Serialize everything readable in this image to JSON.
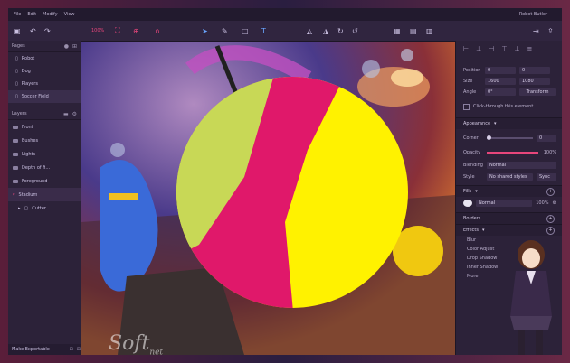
{
  "menu": {
    "items": [
      "File",
      "Edit",
      "Modify",
      "View"
    ],
    "window_title": "Robot Butler"
  },
  "toolbar": {
    "zoom": "100%"
  },
  "pages": {
    "header": "Pages",
    "items": [
      "Robot",
      "Dog",
      "Players",
      "Soccer Field"
    ]
  },
  "layers": {
    "header": "Layers",
    "items": [
      "Front",
      "Bushes",
      "Lights",
      "Depth of fi...",
      "Foreground",
      "Stadium",
      "Cutter"
    ]
  },
  "left_footer": "Make Exportable",
  "inspector": {
    "position_label": "Position",
    "position_x": "0",
    "position_y": "0",
    "size_label": "Size",
    "size_w": "1600",
    "size_h": "1080",
    "angle_label": "Angle",
    "angle_value": "0°",
    "transform_label": "Transform",
    "click_through_label": "Click-through this element",
    "appearance_label": "Appearance",
    "corner_label": "Corner",
    "corner_value": "0",
    "opacity_label": "Opacity",
    "opacity_value": "100%",
    "opacity_fraction": 1.0,
    "blending_label": "Blending",
    "blending_value": "Normal",
    "style_label": "Style",
    "style_value": "No shared styles",
    "sync_label": "Sync",
    "fills_label": "Fills",
    "fill_mode": "Normal",
    "fill_opacity": "100%",
    "borders_label": "Borders",
    "effects_label": "Effects",
    "effects": [
      "Blur",
      "Color Adjust",
      "Drop Shadow",
      "Inner Shadow",
      "More"
    ]
  },
  "watermark": {
    "main": "Soft",
    "suffix": "net"
  },
  "colors": {
    "accent_pink": "#e7467b",
    "circle_yellow": "#fff200",
    "circle_magenta": "#e0186a",
    "circle_lime": "#c8d856"
  }
}
